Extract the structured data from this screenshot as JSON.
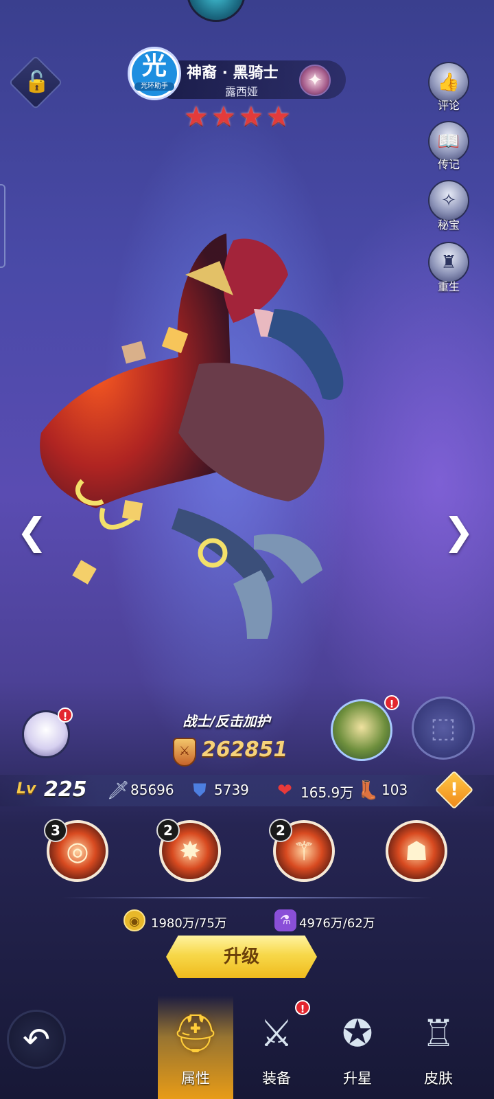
{
  "header": {
    "logo_char": "光",
    "logo_sub": "光环助手",
    "hero_name": "神裔 · 黑骑士",
    "hero_subtitle": "露西娅",
    "star_count": 4,
    "stars": [
      "★",
      "★",
      "★",
      "★"
    ]
  },
  "side_menu": [
    {
      "label": "评论",
      "icon": "thumbs-up-card-icon"
    },
    {
      "label": "传记",
      "icon": "book-icon"
    },
    {
      "label": "秘宝",
      "icon": "treasure-icon"
    },
    {
      "label": "重生",
      "icon": "rebirth-icon"
    }
  ],
  "hero": {
    "class_label": "战士/反击加护",
    "power": "262851"
  },
  "stats": {
    "level_prefix": "Lv",
    "level": "225",
    "attack": "85696",
    "defense": "5739",
    "hp": "165.9万",
    "speed": "103"
  },
  "skills": [
    {
      "level": "3",
      "icon": "shield-ring-skill-icon"
    },
    {
      "level": "2",
      "icon": "burst-skill-icon"
    },
    {
      "level": "2",
      "icon": "claw-skill-icon"
    },
    {
      "level": "",
      "icon": "cloak-skill-icon"
    }
  ],
  "costs": {
    "gold": "1980万/75万",
    "potion": "4976万/62万"
  },
  "upgrade_label": "升级",
  "alerts": {
    "pet": "!",
    "companion": "!",
    "equipment": "!"
  },
  "tabs": [
    {
      "label": "属性",
      "active": true
    },
    {
      "label": "装备",
      "active": false
    },
    {
      "label": "升星",
      "active": false
    },
    {
      "label": "皮肤",
      "active": false
    }
  ],
  "colors": {
    "gold": "#f6d27a",
    "star_red": "#e33b3b",
    "button_yellow": "#f7d84a",
    "alert_red": "#e3262f"
  }
}
